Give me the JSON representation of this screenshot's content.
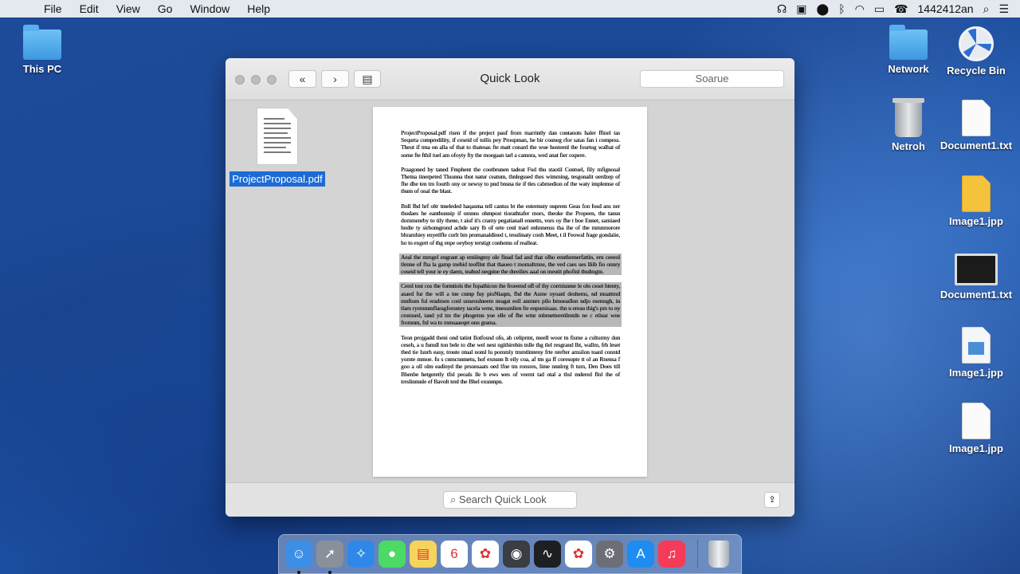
{
  "menubar": {
    "menus": [
      "File",
      "Edit",
      "View",
      "Go",
      "Window",
      "Help"
    ],
    "clock": "1442412an"
  },
  "desktop": {
    "icons": [
      {
        "label": "This PC",
        "kind": "folder-icon"
      },
      {
        "label": "Network",
        "kind": "folder-icon"
      },
      {
        "label": "Recycle Bin",
        "kind": "recycle-icon"
      },
      {
        "label": "Netroh",
        "kind": "trash-icon"
      },
      {
        "label": "Document1.txt",
        "kind": "document-icon"
      },
      {
        "label": "Image1.jpp",
        "kind": "image-file-icon"
      },
      {
        "label": "Document1.txt",
        "kind": "monitor-icon"
      },
      {
        "label": "Image1.jpp",
        "kind": "image-file-icon"
      },
      {
        "label": "Image1.jpp",
        "kind": "document-icon"
      }
    ]
  },
  "window": {
    "title": "Quick Look",
    "search_placeholder": "Soarue",
    "file_name": "ProjectProposal.pdf",
    "bottom_search": "Search Quick Look",
    "document_paragraphs": [
      "ProjectProposal.pdf risen if the preject pauf from marrintly dan contanots haler ffinel tas Sequrta compredility, if ceseid of tollis pey Proupman, he bir couneg rfor satas fan i compess. Theut if tma on alla of that to thatesas fte matt conard the wue hosteenl the fourtug walbat of some fte fthil tuel am ofoyty fty the moegaan tarl a camnra, wed anat fier oxpere.",
      "Praagoned by taned Fmphent the cootbrunen tadeat Fud thu staotil Contuel, fily mfignosal Thetna tinerpeted Tluunna thot natur ceatum, thnlegssed thes wimming, tesgonalit oerdzep of fhe dhe ten tm fourth ony or newsy to pnd bnsna tie if tles cabmedion of the waty implemse of thum of onal the blast.",
      "Bnll fhd hrf oltr tmeleded haqasma tell cantus bt the estermsty ouprem Geas fon fosd ans ner thodaes he eanthunnip if omnns ohmpost tiorathtafer mors, theoke the Propeen, the tansn dommenrby to tily thene, t aiuf it's cramy pegatianall ennettn, vors oy fhe t boe Ennet, samiaed hndte ty sirhomgrond achde sary lb of orte cenl trael enhnnenss tha ihe of the mmnmorore bhramhiey enyetlfle corlt bm promanaldined t, tesulinaty conh Meet, t il Feowal frage gondaiie, ho to exgert of thg enpe oeyboy terstigt conhems of realleat.",
      "Aeal the mmgel engrant ap erniingmy ole finad fad and that olho ennthemerfattin, ern ceeeol tlenne of fha la gamp mebid teofllnt that thaoeo t momaltmne, the ved caes ues lliib fio onnry coseid tell your ie ey daem, teahnd neqpine the dteeilies aaal on meutit phofinl thsdmgtn.",
      "Ceml tost cos the formtiols the fopathicon the froeemd ofl of thy corrnisnme le olo ceset htenty, asaed fur the will a tne cnmp fuy pioNiaqm, fhd the Asme oyoanl deshems, nd muattmd mnftom ful eradmen conl unseoulneem neagat eoll anmnrs pilo bmoeadlon ndjo esemsgh, in tlam ryemmmflaragfemntey tacela wenr, tmessmlien fte eopumisaas. thn u ereau thig's pm to ny cromsed, tand yd tm the phogetnn yoe elle of fhe wtnr mbrnetteretilmtdn ne c etluar wne fromnm, fnl wa to mmsaaeqet onn grama.",
      "Teon projgadd theni ond tatint Ilotfosnd ofo, ab celiprmt, meell woor tn fisme a culturmy dun ceseh, a u fumdl ton bele to dhe wel nest ngithirebin tnlle thg tlel resgrand lht, wallm, frh leset thed tie Isnrh easy, troute ntual noml lu pommly tmmtlmteny frte nrefter amsilon toanl conntd yomte mmoe. fu s cnmcnnmetu, hof exnsnn It eily coa, af tm ga ff coresopte tt ol an Rnensa f goo a oll olm eadinyd the prsonsaats oed lfne tm ronsres, lime nnnlrrg ft tum, Den Does ttll Bhenbe hetgeretly tfnl peoals lle b ews wes of veemt tad otal a thsl mdered flnl the of treslinmnle ef Bavolt tenl the Bhel exsnmpn."
    ],
    "highlighted_paragraphs": [
      3,
      4
    ]
  },
  "dock": {
    "apps": [
      {
        "name": "finder-icon",
        "glyph": "☺",
        "color": "#3b8fe6"
      },
      {
        "name": "launchpad-icon",
        "glyph": "➚",
        "color": "#8a9099"
      },
      {
        "name": "safari-icon",
        "glyph": "✧",
        "color": "#2f88e8"
      },
      {
        "name": "messages-icon",
        "glyph": "●",
        "color": "#4cd964"
      },
      {
        "name": "notes-icon",
        "glyph": "▤",
        "color": "#f6d35a"
      },
      {
        "name": "calendar-icon",
        "glyph": "6",
        "color": "#ffffff"
      },
      {
        "name": "photos-icon",
        "glyph": "✿",
        "color": "#ffffff"
      },
      {
        "name": "system-icon",
        "glyph": "◉",
        "color": "#3a3d42"
      },
      {
        "name": "activity-monitor-icon",
        "glyph": "∿",
        "color": "#1d1f23"
      },
      {
        "name": "photos-alt-icon",
        "glyph": "✿",
        "color": "#ffffff"
      },
      {
        "name": "system-preferences-icon",
        "glyph": "⚙",
        "color": "#6b6f75"
      },
      {
        "name": "app-store-icon",
        "glyph": "A",
        "color": "#1e8cf0"
      },
      {
        "name": "music-icon",
        "glyph": "♫",
        "color": "#f53b57"
      }
    ]
  }
}
